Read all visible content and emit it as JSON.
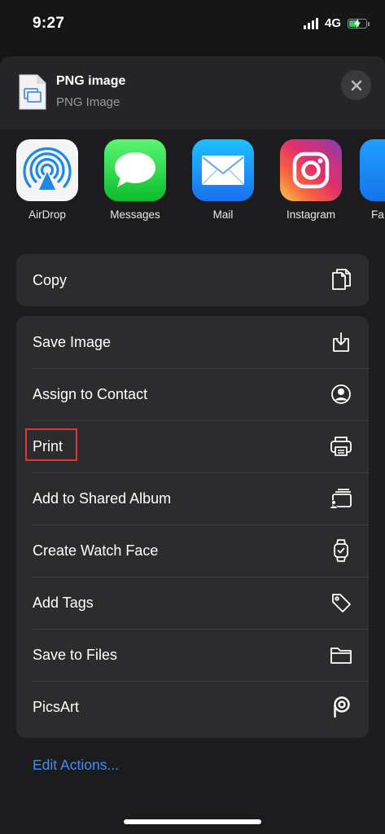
{
  "status_bar": {
    "time": "9:27",
    "network": "4G",
    "battery_level": 0.62,
    "battery_color": "#34c759"
  },
  "header": {
    "title": "PNG image",
    "subtitle": "PNG Image",
    "file_icon": "image-file-icon",
    "close_icon": "close-icon"
  },
  "apps": [
    {
      "label": "AirDrop",
      "icon": "airdrop-icon"
    },
    {
      "label": "Messages",
      "icon": "messages-icon"
    },
    {
      "label": "Mail",
      "icon": "mail-icon"
    },
    {
      "label": "Instagram",
      "icon": "instagram-icon"
    },
    {
      "label": "Fa",
      "icon": "facebook-icon"
    }
  ],
  "copy_group": [
    {
      "label": "Copy",
      "icon": "copy-icon"
    }
  ],
  "actions": [
    {
      "label": "Save Image",
      "icon": "save-image-icon"
    },
    {
      "label": "Assign to Contact",
      "icon": "contact-icon"
    },
    {
      "label": "Print",
      "icon": "printer-icon",
      "highlighted": true
    },
    {
      "label": "Add to Shared Album",
      "icon": "shared-album-icon"
    },
    {
      "label": "Create Watch Face",
      "icon": "watch-icon"
    },
    {
      "label": "Add Tags",
      "icon": "tag-icon"
    },
    {
      "label": "Save to Files",
      "icon": "folder-icon"
    },
    {
      "label": "PicsArt",
      "icon": "picsart-icon"
    }
  ],
  "edit_actions_label": "Edit Actions...",
  "colors": {
    "accent": "#3e8ff5",
    "highlight": "#e03636",
    "sheet": "#1c1c1e",
    "group": "#2c2c2e"
  }
}
